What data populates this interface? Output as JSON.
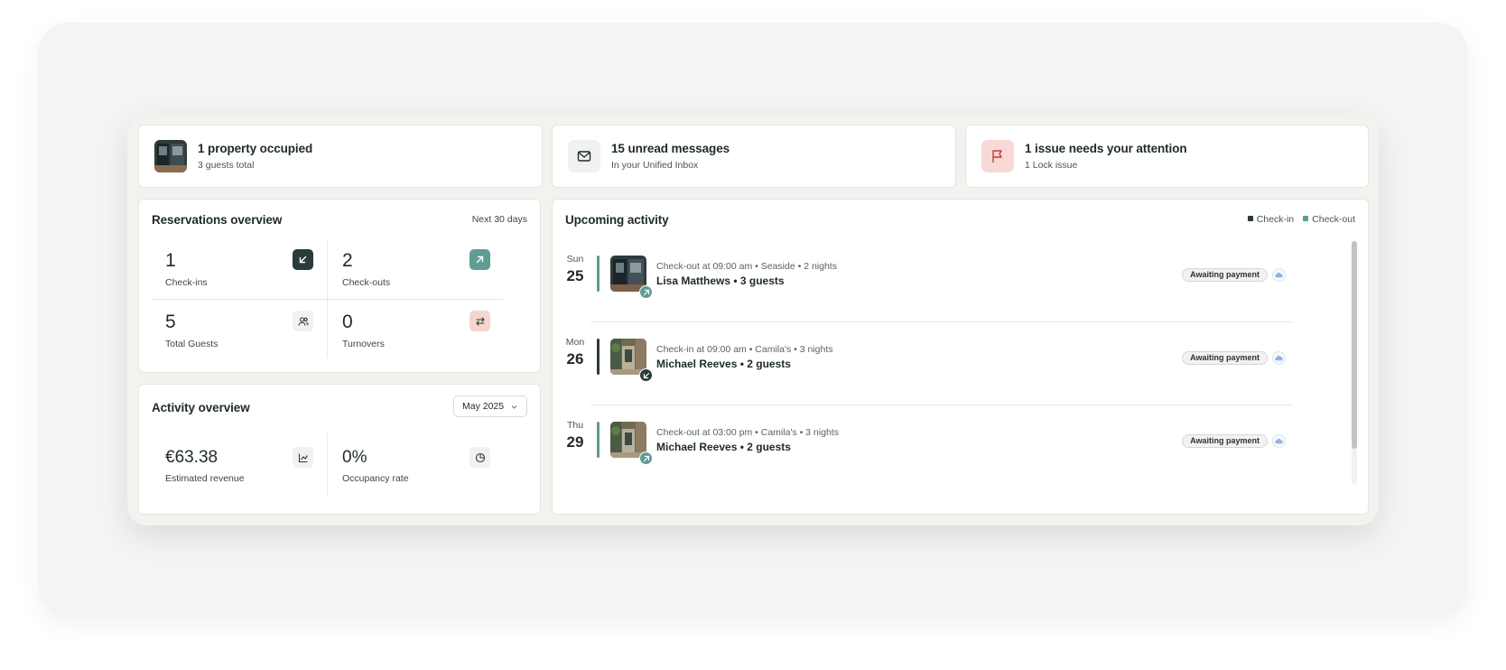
{
  "stats": [
    {
      "title": "1 property occupied",
      "subtitle": "3 guests total",
      "icon": "property-thumbnail"
    },
    {
      "title": "15 unread messages",
      "subtitle": "In your Unified Inbox",
      "icon": "mail-icon"
    },
    {
      "title": "1 issue needs your attention",
      "subtitle": "1 Lock issue",
      "icon": "flag-icon",
      "accent": "#c53b3b"
    }
  ],
  "reservations": {
    "title": "Reservations overview",
    "range": "Next 30 days",
    "metrics": [
      {
        "value": "1",
        "label": "Check-ins",
        "icon": "arrow-down-left-icon"
      },
      {
        "value": "2",
        "label": "Check-outs",
        "icon": "arrow-up-right-icon"
      },
      {
        "value": "5",
        "label": "Total Guests",
        "icon": "users-icon"
      },
      {
        "value": "0",
        "label": "Turnovers",
        "icon": "swap-icon"
      }
    ]
  },
  "activity_overview": {
    "title": "Activity overview",
    "period": "May 2025",
    "metrics": [
      {
        "value": "€63.38",
        "label": "Estimated revenue",
        "icon": "line-chart-icon"
      },
      {
        "value": "0%",
        "label": "Occupancy rate",
        "icon": "pie-chart-icon"
      }
    ]
  },
  "upcoming": {
    "title": "Upcoming activity",
    "legend": [
      {
        "label": "Check-in",
        "color": "#2b3a3a"
      },
      {
        "label": "Check-out",
        "color": "#5e9c94"
      }
    ],
    "items": [
      {
        "dow": "Sun",
        "day": "25",
        "type": "checkout",
        "meta": "Check-out at 09:00 am • Seaside • 2 nights",
        "guest": "Lisa Matthews • 3 guests",
        "status": "Awaiting payment"
      },
      {
        "dow": "Mon",
        "day": "26",
        "type": "checkin",
        "meta": "Check-in at 09:00 am • Camila's • 3 nights",
        "guest": "Michael Reeves • 2 guests",
        "status": "Awaiting payment"
      },
      {
        "dow": "Thu",
        "day": "29",
        "type": "checkout",
        "meta": "Check-out at 03:00 pm • Camila's • 3 nights",
        "guest": "Michael Reeves • 2 guests",
        "status": "Awaiting payment"
      }
    ]
  },
  "colors": {
    "checkin": "#2b3a3a",
    "checkout": "#5e9c94",
    "swap_bg": "#f6d5cf",
    "flag_bg": "#f8d9d6"
  }
}
